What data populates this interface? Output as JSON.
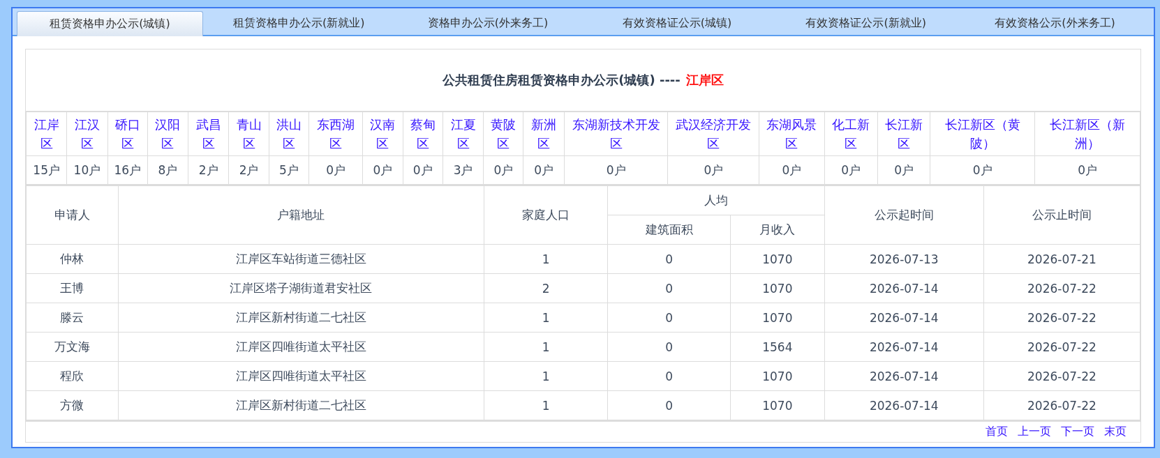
{
  "tabs": [
    {
      "label": "租赁资格申办公示(城镇)",
      "selected": true
    },
    {
      "label": "租赁资格申办公示(新就业)",
      "selected": false
    },
    {
      "label": "资格申办公示(外来务工)",
      "selected": false
    },
    {
      "label": "有效资格证公示(城镇)",
      "selected": false
    },
    {
      "label": "有效资格证公示(新就业)",
      "selected": false
    },
    {
      "label": "有效资格公示(外来务工)",
      "selected": false
    }
  ],
  "notice": {
    "title": "公共租赁住房租赁资格申办公示(城镇) ----",
    "district": "江岸区"
  },
  "districts": [
    {
      "name": "江岸区",
      "count": "15户"
    },
    {
      "name": "江汉区",
      "count": "10户"
    },
    {
      "name": "硚口区",
      "count": "16户"
    },
    {
      "name": "汉阳区",
      "count": "8户"
    },
    {
      "name": "武昌区",
      "count": "2户"
    },
    {
      "name": "青山区",
      "count": "2户"
    },
    {
      "name": "洪山区",
      "count": "5户"
    },
    {
      "name": "东西湖区",
      "count": "0户"
    },
    {
      "name": "汉南区",
      "count": "0户"
    },
    {
      "name": "蔡甸区",
      "count": "0户"
    },
    {
      "name": "江夏区",
      "count": "3户"
    },
    {
      "name": "黄陂区",
      "count": "0户"
    },
    {
      "name": "新洲区",
      "count": "0户"
    },
    {
      "name": "东湖新技术开发区",
      "count": "0户"
    },
    {
      "name": "武汉经济开发区",
      "count": "0户"
    },
    {
      "name": "东湖风景区",
      "count": "0户"
    },
    {
      "name": "化工新区",
      "count": "0户"
    },
    {
      "name": "长江新区",
      "count": "0户"
    },
    {
      "name": "长江新区（黄陂）",
      "count": "0户"
    },
    {
      "name": "长江新区（新洲）",
      "count": "0户"
    }
  ],
  "table": {
    "header_rows": [
      [
        {
          "label": "申请人",
          "rowspan": 2
        },
        {
          "label": "户籍地址",
          "rowspan": 2
        },
        {
          "label": "家庭人口",
          "rowspan": 2
        },
        {
          "label": "人均",
          "colspan": 2
        },
        {
          "label": "公示起时间",
          "rowspan": 2
        },
        {
          "label": "公示止时间",
          "rowspan": 2
        }
      ],
      [
        {
          "label": "建筑面积"
        },
        {
          "label": "月收入"
        }
      ]
    ],
    "rows": [
      [
        "仲林",
        "江岸区车站街道三德社区",
        "1",
        "0",
        "1070",
        "2026-07-13",
        "2026-07-21"
      ],
      [
        "王博",
        "江岸区塔子湖街道君安社区",
        "2",
        "0",
        "1070",
        "2026-07-14",
        "2026-07-22"
      ],
      [
        "滕云",
        "江岸区新村街道二七社区",
        "1",
        "0",
        "1070",
        "2026-07-14",
        "2026-07-22"
      ],
      [
        "万文海",
        "江岸区四唯街道太平社区",
        "1",
        "0",
        "1564",
        "2026-07-14",
        "2026-07-22"
      ],
      [
        "程欣",
        "江岸区四唯街道太平社区",
        "1",
        "0",
        "1070",
        "2026-07-14",
        "2026-07-22"
      ],
      [
        "方微",
        "江岸区新村街道二七社区",
        "1",
        "0",
        "1070",
        "2026-07-14",
        "2026-07-22"
      ]
    ]
  },
  "pager": [
    "首页",
    "上一页",
    "下一页",
    "末页"
  ]
}
